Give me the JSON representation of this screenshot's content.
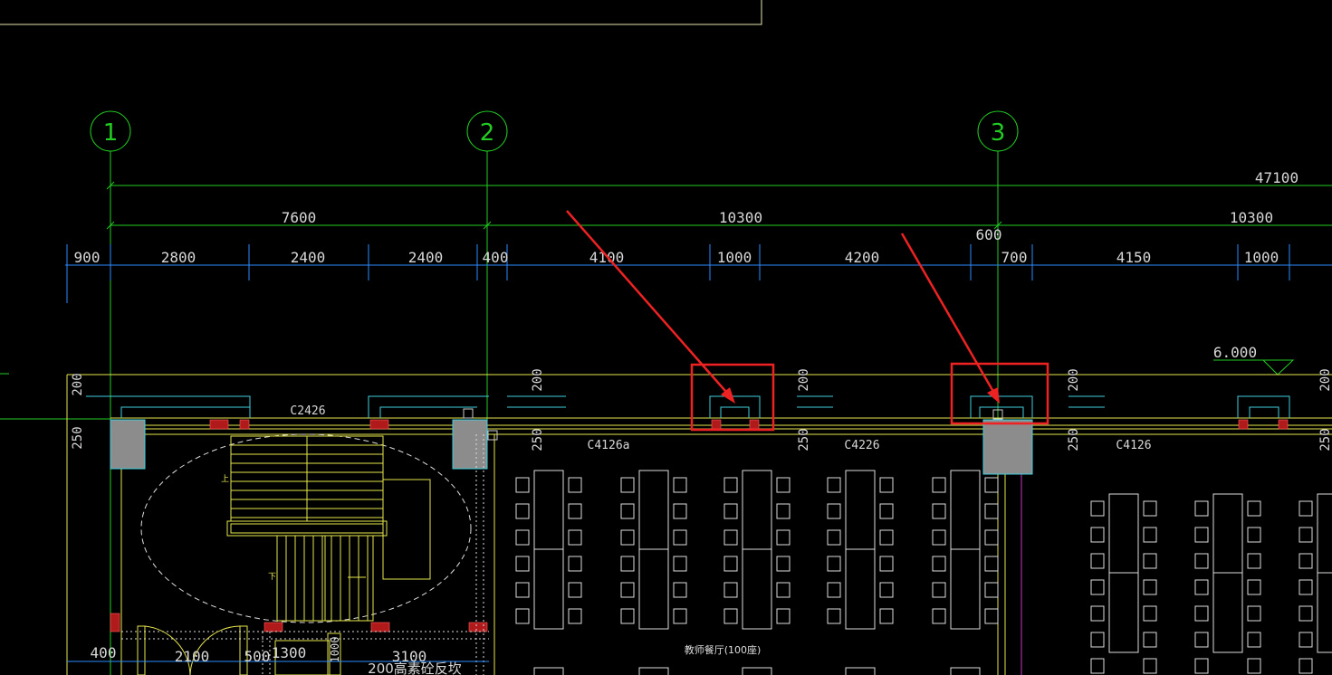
{
  "colors": {
    "background": "#000000",
    "grid_axis": "#22cc22",
    "dimension_blue": "#2d8cff",
    "wall_yellow": "#e6e64d",
    "column_gray": "#8c8c8c",
    "column_outline": "#40d0e0",
    "dimension_text": "#d8d8d8",
    "highlight_red": "#ee2222",
    "partition_magenta": "#cc33cc"
  },
  "axes": {
    "a1": "1",
    "a2": "2",
    "a3": "3"
  },
  "dimensions": {
    "overall": "47100",
    "bay_1_2": "7600",
    "bay_2_3": "10300",
    "bay_3_4": "10300",
    "offset_600": "600",
    "detail": [
      "900",
      "2800",
      "2400",
      "2400",
      "400",
      "4100",
      "1000",
      "4200",
      "700",
      "4150",
      "1000"
    ],
    "wall_200_a": "200",
    "wall_250_a": "250",
    "wall_200_b": "200",
    "wall_250_b": "250",
    "wall_200_c": "200",
    "wall_250_c": "250",
    "wall_200_d": "200",
    "wall_250_d": "250",
    "wall_200_e": "200",
    "wall_250_e": "250",
    "bottom_400": "400",
    "bottom_2100": "2100",
    "bottom_500": "500",
    "bottom_1300": "1300",
    "bottom_3100": "3100",
    "bottom_1000": "1000"
  },
  "windows": {
    "w1": "C2426",
    "w2": "C4126a",
    "w3": "C4226",
    "w4": "C4126"
  },
  "elevation": "6.000",
  "room_label": "教师餐厅(100座)",
  "floor_note": "200高素砼反坎",
  "stair": {
    "up": "上",
    "down": "下"
  }
}
